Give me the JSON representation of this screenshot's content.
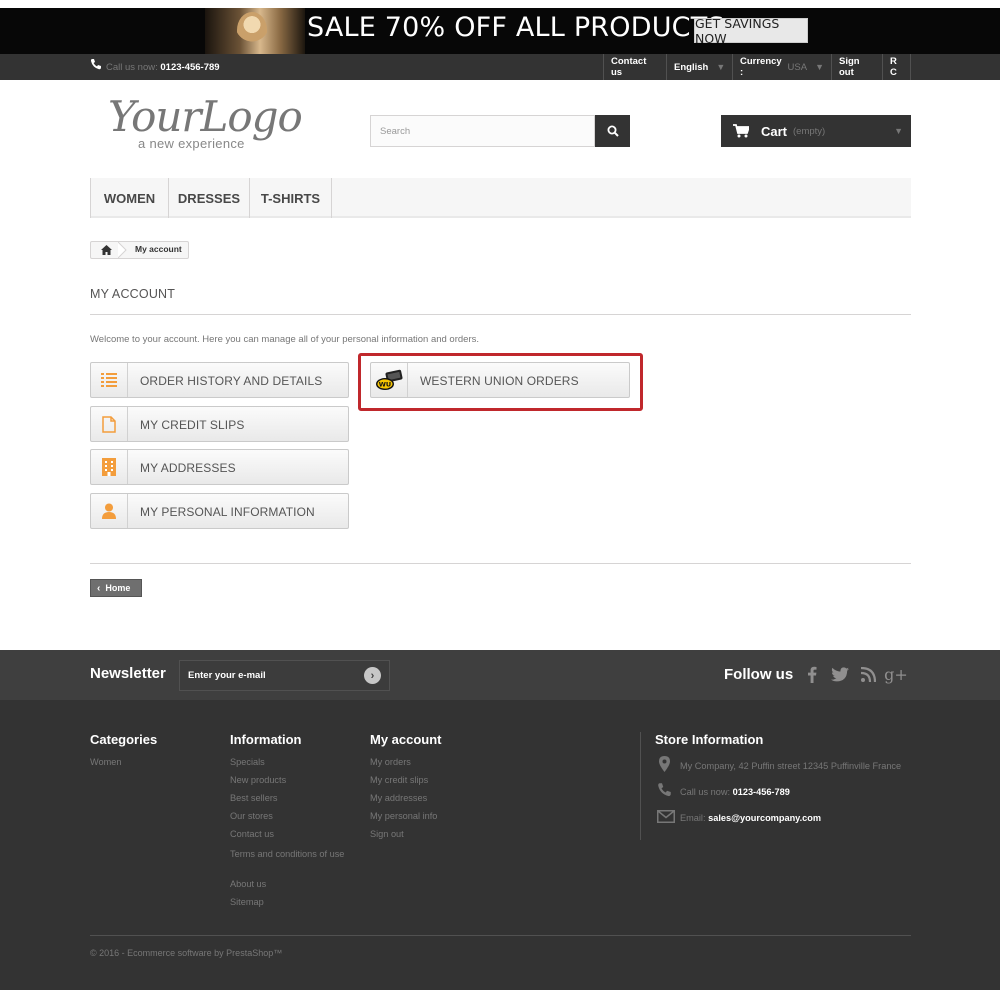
{
  "banner": {
    "sale_text": "SALE 70% OFF ALL PRODUCTS",
    "button_label": "GET SAVINGS NOW"
  },
  "nav": {
    "call_label": "Call us now: ",
    "call_number": "0123-456-789",
    "contact": "Contact us",
    "language": "English",
    "currency_label": "Currency :",
    "currency_value": "USA",
    "sign_out": "Sign out",
    "user": "R C"
  },
  "header": {
    "logo_main": "YourLogo",
    "logo_tagline": "a new experience",
    "search_placeholder": "Search",
    "cart_label": "Cart",
    "cart_status": "(empty)"
  },
  "menu": {
    "items": [
      "WOMEN",
      "DRESSES",
      "T-SHIRTS"
    ]
  },
  "breadcrumb": {
    "current": "My account"
  },
  "page": {
    "title": "MY ACCOUNT",
    "welcome": "Welcome to your account. Here you can manage all of your personal information and orders."
  },
  "account_links": {
    "order_history": "ORDER HISTORY AND DETAILS",
    "credit_slips": "MY CREDIT SLIPS",
    "addresses": "MY ADDRESSES",
    "personal_info": "MY PERSONAL INFORMATION",
    "western_union": "WESTERN UNION ORDERS",
    "wu_badge": "WU"
  },
  "home_button": "Home",
  "newsletter": {
    "title": "Newsletter",
    "placeholder": "Enter your e-mail",
    "follow_title": "Follow us"
  },
  "footer": {
    "categories_title": "Categories",
    "categories": [
      "Women"
    ],
    "information_title": "Information",
    "information": [
      "Specials",
      "New products",
      "Best sellers",
      "Our stores",
      "Contact us",
      "Terms and conditions of use",
      "About us",
      "Sitemap"
    ],
    "account_title": "My account",
    "account": [
      "My orders",
      "My credit slips",
      "My addresses",
      "My personal info",
      "Sign out"
    ],
    "store_title": "Store Information",
    "store_address": "My Company, 42 Puffin street 12345 Puffinville France",
    "store_call_label": "Call us now: ",
    "store_call_number": "0123-456-789",
    "store_email_label": "Email: ",
    "store_email": "sales@yourcompany.com",
    "copyright": "© 2016 - Ecommerce software by PrestaShop™"
  },
  "colors": {
    "accent_orange": "#f39d3c",
    "highlight_red": "#c0282c",
    "dark_bar": "#333333"
  }
}
